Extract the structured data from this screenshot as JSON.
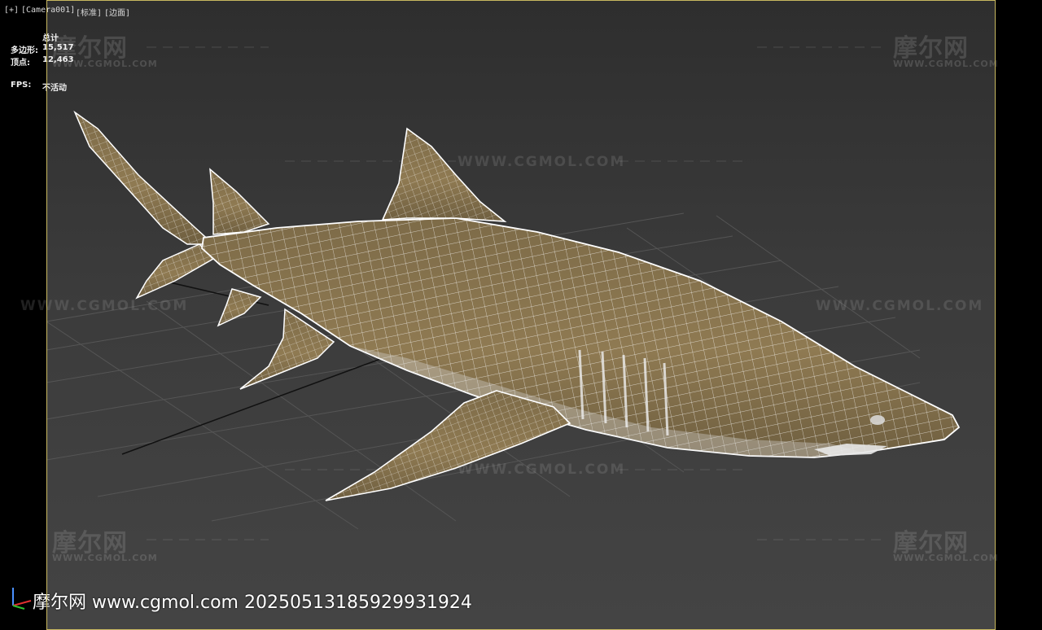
{
  "viewport": {
    "labels": [
      "[+]",
      "[Camera001]",
      "[标准]",
      "[边面]"
    ],
    "frame_color": "#c8b860",
    "background_top": "#4a4a4a",
    "background_bottom": "#2a2a2a"
  },
  "stats": {
    "total_label": "总计",
    "polygons_label": "多边形:",
    "polygons_value": "15,517",
    "vertices_label": "顶点:",
    "vertices_value": "12,463",
    "fps_label": "FPS:",
    "fps_value": "不活动"
  },
  "watermark": {
    "brand": "摩尔网",
    "brand_url": "WWW.CGMOL.COM",
    "url_line": "WWW.CGMOL.COM",
    "footer": "摩尔网 www.cgmol.com 20250513185929931924"
  },
  "model": {
    "icon": "shark-wireframe-model",
    "skin_color": "#8a7550",
    "wire_color": "#ffffff"
  },
  "gizmo": {
    "icon": "axis-gizmo-icon"
  }
}
